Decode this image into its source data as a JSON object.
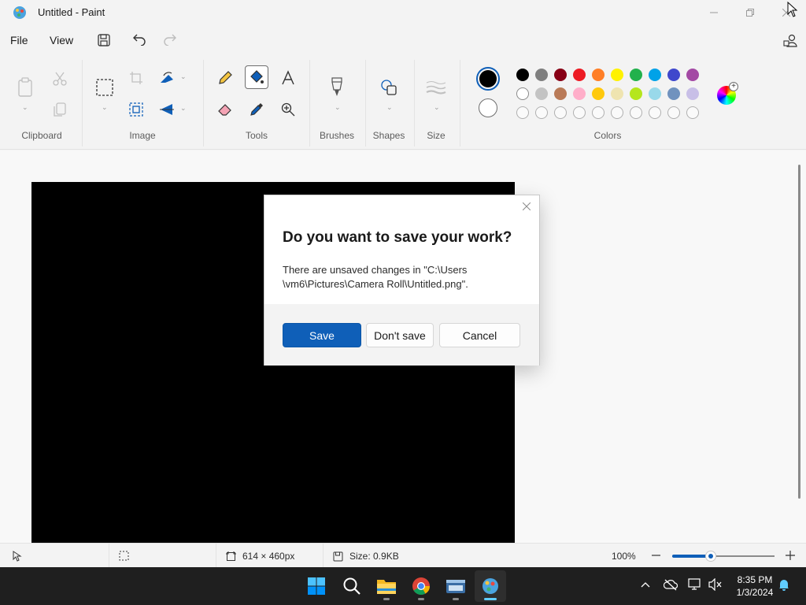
{
  "window": {
    "title": "Untitled - Paint"
  },
  "menu": {
    "file": "File",
    "view": "View"
  },
  "ribbon": {
    "groups": {
      "clipboard": "Clipboard",
      "image": "Image",
      "tools": "Tools",
      "brushes": "Brushes",
      "shapes": "Shapes",
      "size": "Size",
      "colors": "Colors"
    },
    "selected_tool": "fill-tool",
    "primary_color": "#000000",
    "secondary_color": "#ffffff",
    "palette_row1": [
      "#000000",
      "#7f7f7f",
      "#880015",
      "#ed1c24",
      "#ff7f27",
      "#fff200",
      "#22b14c",
      "#00a2e8",
      "#3f48cc",
      "#a349a4"
    ],
    "palette_row2": [
      "#ffffff",
      "#c3c3c3",
      "#b97a57",
      "#ffaec9",
      "#ffc90e",
      "#efe4b0",
      "#b5e61d",
      "#99d9ea",
      "#7092be",
      "#c8bfe7"
    ],
    "palette_row3_count": 10
  },
  "dialog": {
    "title": "Do you want to save your work?",
    "message": "There are unsaved changes in \"C:\\Users \\vm6\\Pictures\\Camera Roll\\Untitled.png\".",
    "save": "Save",
    "dont_save": "Don't save",
    "cancel": "Cancel"
  },
  "status": {
    "canvas_size": "614 × 460px",
    "file_size": "Size: 0.9KB",
    "zoom": "100%",
    "zoom_fraction": 0.38
  },
  "taskbar": {
    "time": "8:35 PM",
    "date": "1/3/2024",
    "apps": [
      "start-icon",
      "search-icon",
      "file-explorer-icon",
      "chrome-icon",
      "terminal-icon",
      "paint-icon"
    ],
    "active_app": "paint-icon"
  },
  "colors": {
    "accent": "#0f5fb8",
    "taskbar": "#1f1f1f",
    "active_indicator": "#60cdff"
  }
}
